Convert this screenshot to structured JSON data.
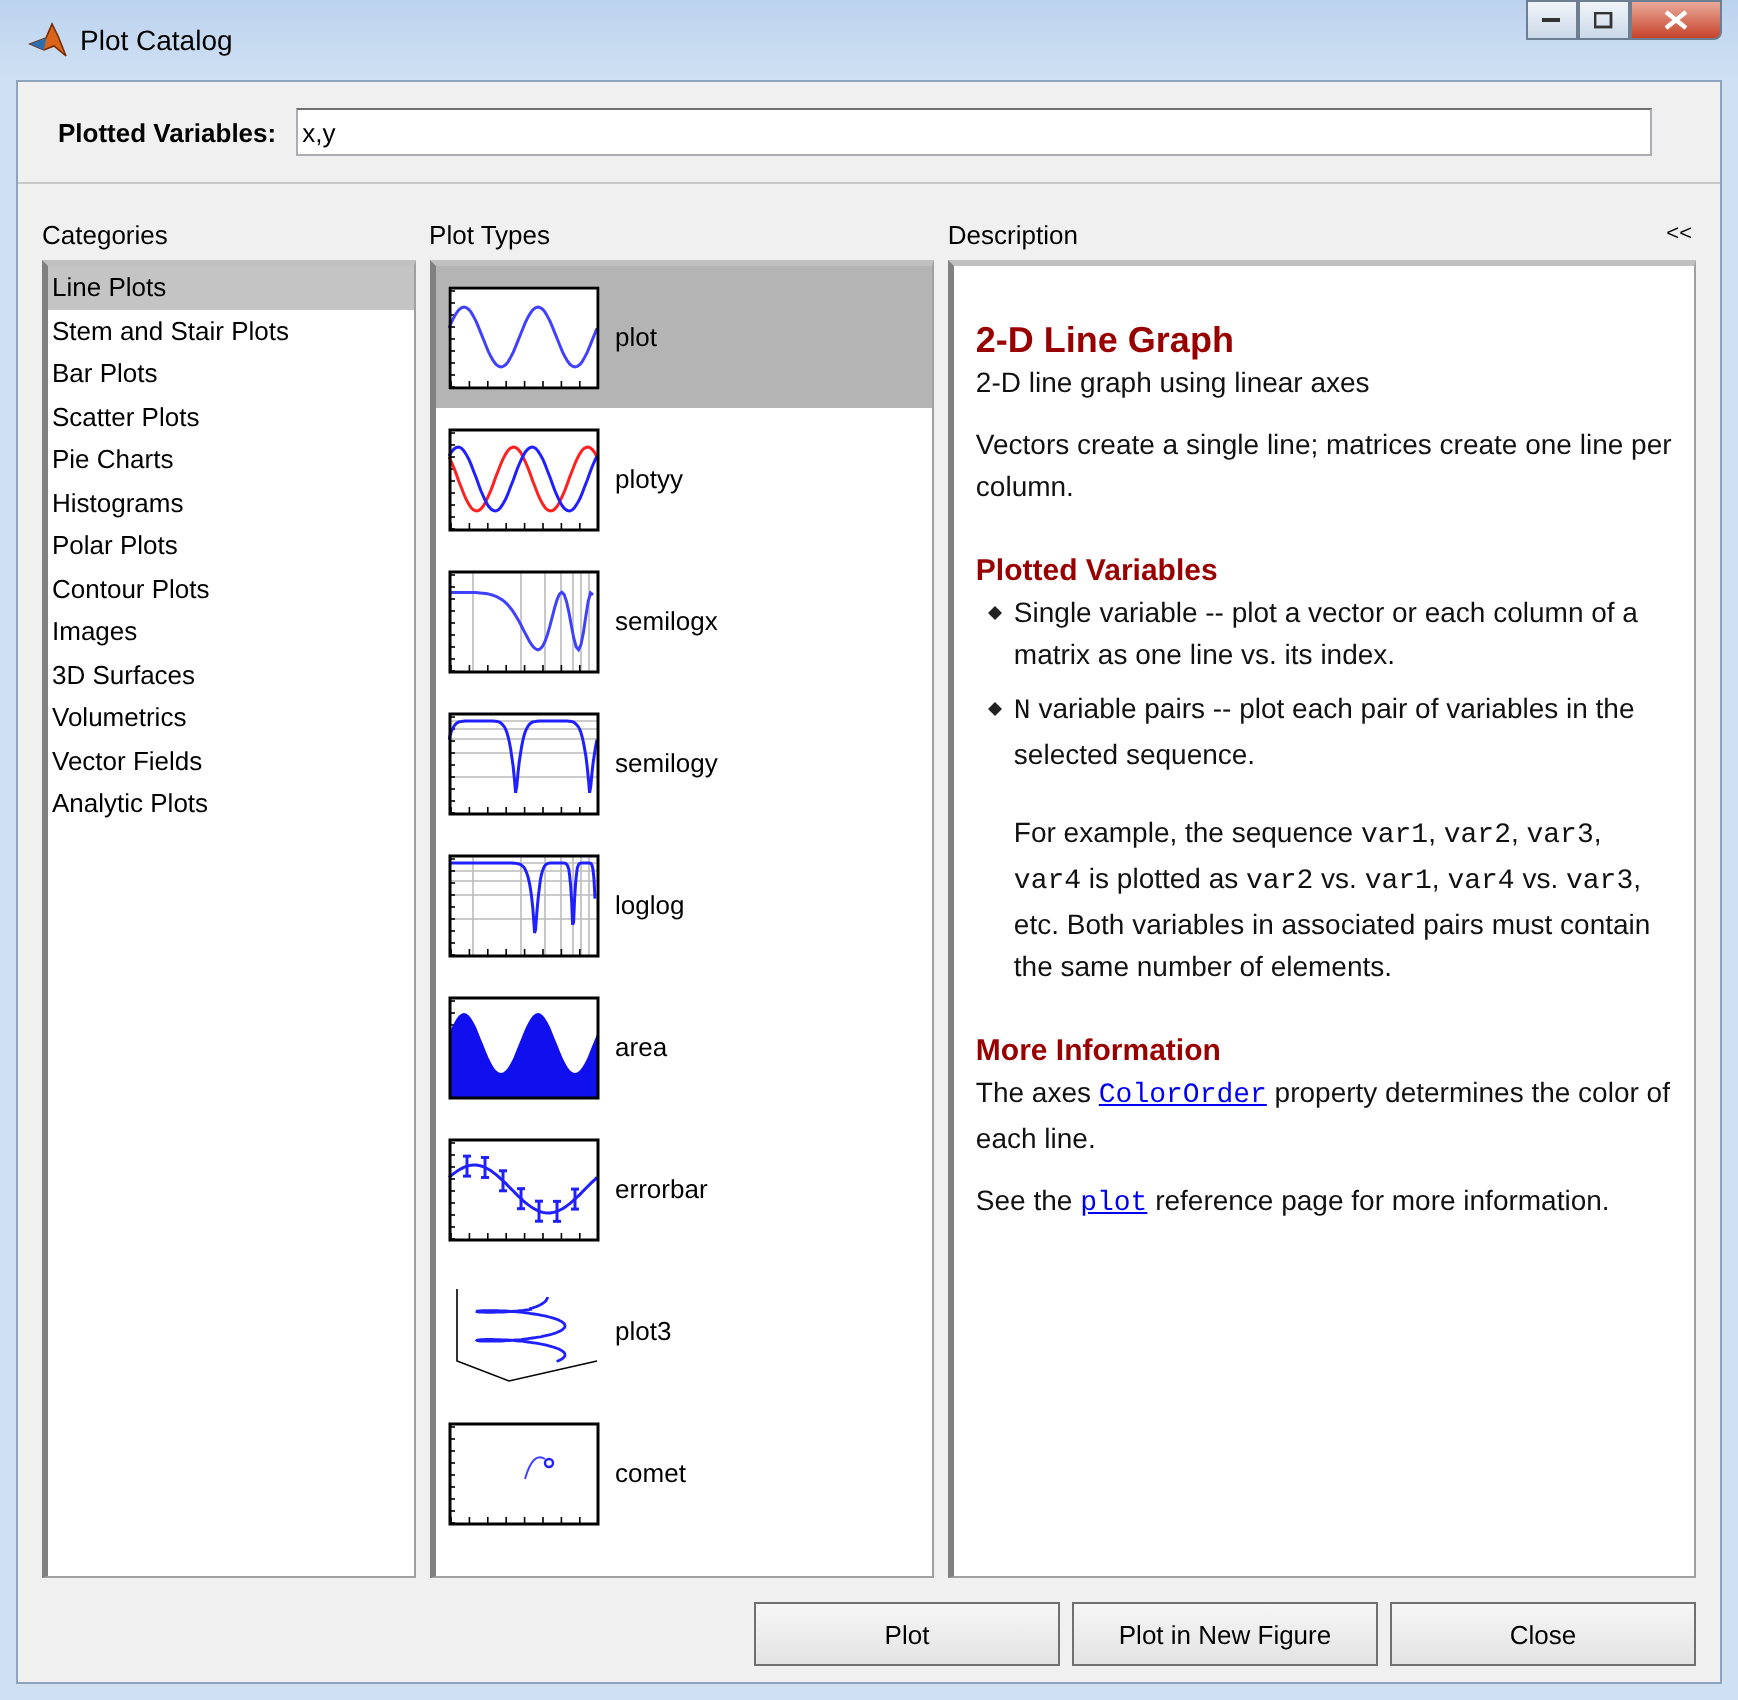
{
  "window": {
    "title": "Plot Catalog"
  },
  "plotted_variables": {
    "label": "Plotted Variables:",
    "value": "x,y"
  },
  "categories": {
    "heading": "Categories",
    "items": [
      {
        "label": "Line Plots",
        "selected": true
      },
      {
        "label": "Stem and Stair Plots",
        "selected": false
      },
      {
        "label": "Bar Plots",
        "selected": false
      },
      {
        "label": "Scatter Plots",
        "selected": false
      },
      {
        "label": "Pie Charts",
        "selected": false
      },
      {
        "label": "Histograms",
        "selected": false
      },
      {
        "label": "Polar Plots",
        "selected": false
      },
      {
        "label": "Contour Plots",
        "selected": false
      },
      {
        "label": "Images",
        "selected": false
      },
      {
        "label": "3D Surfaces",
        "selected": false
      },
      {
        "label": "Volumetrics",
        "selected": false
      },
      {
        "label": "Vector Fields",
        "selected": false
      },
      {
        "label": "Analytic Plots",
        "selected": false
      }
    ]
  },
  "plot_types": {
    "heading": "Plot Types",
    "items": [
      {
        "label": "plot",
        "kind": "line",
        "selected": true
      },
      {
        "label": "plotyy",
        "kind": "dual",
        "selected": false
      },
      {
        "label": "semilogx",
        "kind": "semilogx",
        "selected": false
      },
      {
        "label": "semilogy",
        "kind": "semilogy",
        "selected": false
      },
      {
        "label": "loglog",
        "kind": "loglog",
        "selected": false
      },
      {
        "label": "area",
        "kind": "area",
        "selected": false
      },
      {
        "label": "errorbar",
        "kind": "errorbar",
        "selected": false
      },
      {
        "label": "plot3",
        "kind": "helix",
        "selected": false
      },
      {
        "label": "comet",
        "kind": "comet",
        "selected": false
      }
    ]
  },
  "description": {
    "heading": "Description",
    "collapse": "<<",
    "title": "2-D Line Graph",
    "subtitle": "2-D line graph using linear axes",
    "intro": "Vectors create a single line; matrices create one line per column.",
    "sections": [
      {
        "heading": "Plotted Variables",
        "blocks": [
          {
            "kind": "bullet",
            "parts": [
              {
                "kind": "text",
                "text": "Single variable -- plot a vector or each column of a matrix as one line vs. its index."
              }
            ]
          },
          {
            "kind": "bullet",
            "parts": [
              {
                "kind": "code",
                "text": "N"
              },
              {
                "kind": "text",
                "text": " variable pairs -- plot each pair of variables in the selected sequence."
              }
            ]
          },
          {
            "kind": "note",
            "parts": [
              {
                "kind": "text",
                "text": "For example, the sequence "
              },
              {
                "kind": "code",
                "text": "var1"
              },
              {
                "kind": "text",
                "text": ", "
              },
              {
                "kind": "code",
                "text": "var2"
              },
              {
                "kind": "text",
                "text": ", "
              },
              {
                "kind": "code",
                "text": "var3"
              },
              {
                "kind": "text",
                "text": ", "
              },
              {
                "kind": "code",
                "text": "var4"
              },
              {
                "kind": "text",
                "text": " is plotted as "
              },
              {
                "kind": "code",
                "text": "var2"
              },
              {
                "kind": "text",
                "text": " vs. "
              },
              {
                "kind": "code",
                "text": "var1"
              },
              {
                "kind": "text",
                "text": ", "
              },
              {
                "kind": "code",
                "text": "var4"
              },
              {
                "kind": "text",
                "text": " vs. "
              },
              {
                "kind": "code",
                "text": "var3"
              },
              {
                "kind": "text",
                "text": ", etc. Both variables in associated pairs must contain the same number of elements."
              }
            ]
          }
        ]
      },
      {
        "heading": "More Information",
        "blocks": [
          {
            "kind": "para",
            "parts": [
              {
                "kind": "text",
                "text": "The axes "
              },
              {
                "kind": "link",
                "text": "ColorOrder"
              },
              {
                "kind": "text",
                "text": " property determines the color of each line."
              }
            ]
          },
          {
            "kind": "para",
            "parts": [
              {
                "kind": "text",
                "text": "See the "
              },
              {
                "kind": "link",
                "text": "plot"
              },
              {
                "kind": "text",
                "text": " reference page for more information."
              }
            ]
          }
        ]
      }
    ]
  },
  "buttons": [
    "Plot",
    "Plot in New Figure",
    "Close"
  ]
}
